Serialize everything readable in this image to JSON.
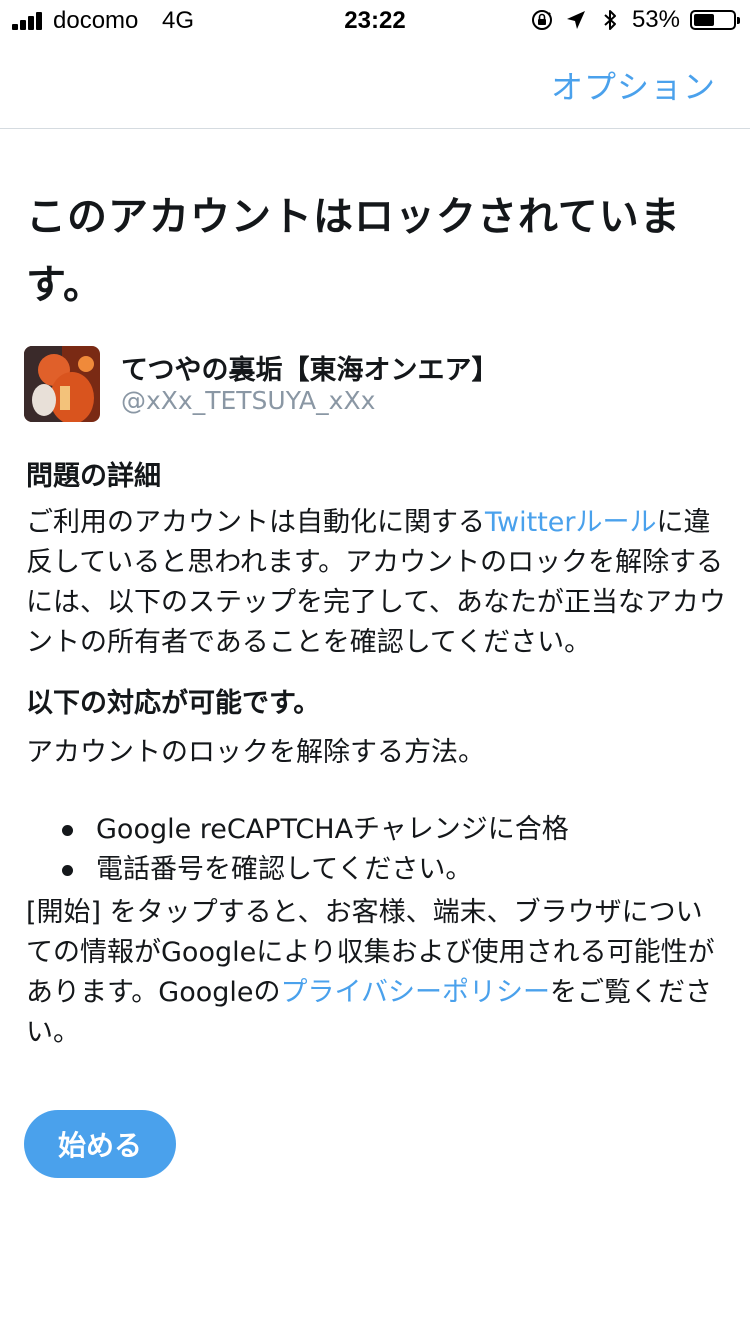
{
  "status_bar": {
    "carrier": "docomo",
    "network": "4G",
    "time": "23:22",
    "battery_percent": "53%",
    "battery_level": 0.53,
    "icons": [
      "signal-icon",
      "orientation-lock-icon",
      "location-arrow-icon",
      "bluetooth-icon",
      "battery-icon"
    ]
  },
  "nav": {
    "options_label": "オプション"
  },
  "page": {
    "title": "このアカウントはロックされています。"
  },
  "account": {
    "display_name": "てつやの裏垢【東海オンエア】",
    "handle": "@xXx_TETSUYA_xXx"
  },
  "details": {
    "heading": "問題の詳細",
    "text_before_link": "ご利用のアカウントは自動化に関する",
    "link_text": "Twitterルール",
    "text_after_link": "に違反していると思われます。アカウントのロックを解除するには、以下のステップを完了して、あなたが正当なアカウントの所有者であることを確認してください。"
  },
  "actions": {
    "heading": "以下の対応が可能です。",
    "intro": "アカウントのロックを解除する方法。",
    "options": [
      "Google reCAPTCHAチャレンジに合格",
      "電話番号を確認してください。"
    ]
  },
  "notice": {
    "text_before_link": "[開始] をタップすると、お客様、端末、ブラウザについての情報がGoogleにより収集および使用される可能性があります。Googleの",
    "link_text": "プライバシーポリシー",
    "text_after_link": "をご覧ください。"
  },
  "start_button": {
    "label": "始める"
  },
  "colors": {
    "accent": "#4aa1ec",
    "text": "#14171a",
    "handle": "#8a97a4",
    "divider": "#d5dbe0"
  }
}
